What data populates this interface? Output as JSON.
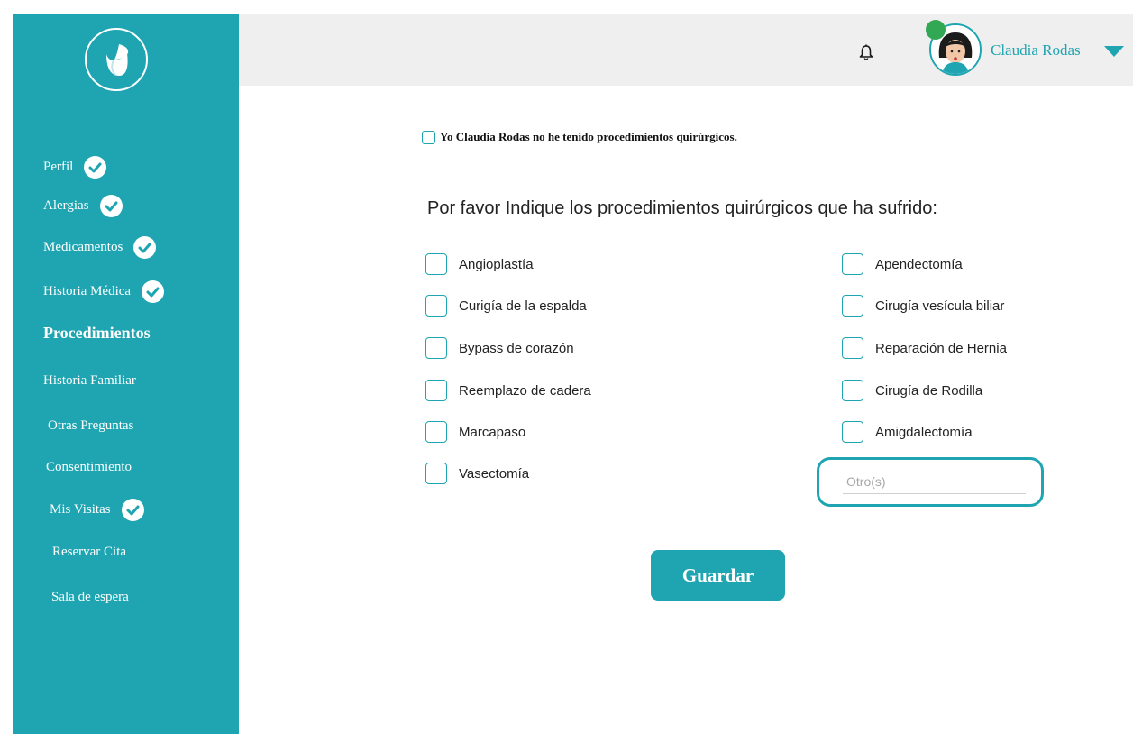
{
  "sidebar": {
    "items": [
      {
        "label": "Perfil",
        "completed": true
      },
      {
        "label": "Alergias",
        "completed": true
      },
      {
        "label": "Medicamentos",
        "completed": true
      },
      {
        "label": "Historia Médica",
        "completed": true
      },
      {
        "label": "Procedimientos",
        "completed": false,
        "active": true
      },
      {
        "label": "Historia Familiar",
        "completed": false
      },
      {
        "label": "Otras Preguntas",
        "completed": false
      },
      {
        "label": "Consentimiento",
        "completed": false
      },
      {
        "label": "Mis Visitas",
        "completed": true
      },
      {
        "label": "Reservar Cita",
        "completed": false
      },
      {
        "label": "Sala de espera",
        "completed": false
      }
    ]
  },
  "header": {
    "user_name": "Claudia Rodas",
    "status": "online"
  },
  "main": {
    "no_procedures_label": "Yo Claudia Rodas no he tenido procedimientos quirúrgicos.",
    "question": "Por favor Indique los procedimientos quirúrgicos que ha sufrido:",
    "procedures_left": [
      "Angioplastía",
      "Curigía de la espalda",
      "Bypass de corazón",
      "Reemplazo de cadera",
      "Marcapaso",
      "Vasectomía"
    ],
    "procedures_right": [
      "Apendectomía",
      "Cirugía vesícula biliar",
      "Reparación de Hernia",
      "Cirugía de Rodilla",
      "Amigdalectomía"
    ],
    "other_placeholder": "Otro(s)",
    "other_value": "",
    "save_label": "Guardar"
  },
  "colors": {
    "accent": "#1fa5b1",
    "topbar": "#efefef",
    "status_online": "#33a854"
  },
  "icons": {
    "logo": "leaf-logo-icon",
    "notification": "bell-icon",
    "completed": "check-circle-icon",
    "menu": "caret-down-icon"
  }
}
